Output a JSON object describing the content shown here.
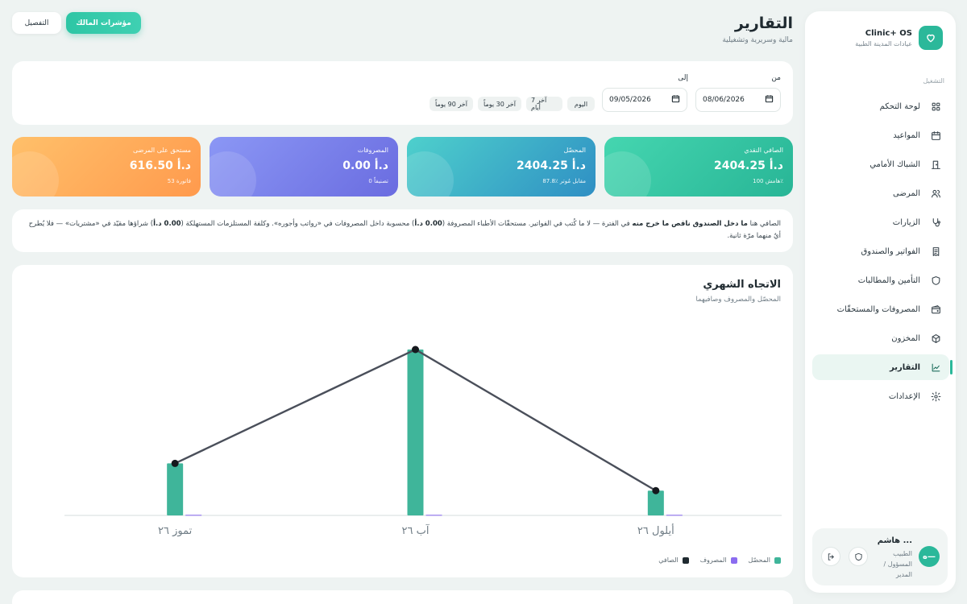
{
  "brand": {
    "name": "Clinic+ OS",
    "subtitle": "عيادات المدينة الطبية"
  },
  "sidebar": {
    "section": "التشغيل",
    "items": [
      {
        "label": "لوحة التحكم",
        "icon": "grid-icon"
      },
      {
        "label": "المواعيد",
        "icon": "calendar-icon"
      },
      {
        "label": "الشباك الأمامي",
        "icon": "door-icon"
      },
      {
        "label": "المرضى",
        "icon": "users-icon"
      },
      {
        "label": "الزيارات",
        "icon": "stethoscope-icon"
      },
      {
        "label": "الفواتير والصندوق",
        "icon": "receipt-icon"
      },
      {
        "label": "التأمين والمطالبات",
        "icon": "shield-icon"
      },
      {
        "label": "المصروفات والمستحقّات",
        "icon": "wallet-icon"
      },
      {
        "label": "المخزون",
        "icon": "box-icon"
      },
      {
        "label": "التقارير",
        "icon": "chart-icon",
        "active": true
      },
      {
        "label": "الإعدادات",
        "icon": "gear-icon"
      }
    ]
  },
  "user": {
    "name": "هاشم ...",
    "role": "الطبيب المسؤول / المدير",
    "avatar": "ه—"
  },
  "header": {
    "title": "التقارير",
    "subtitle": "مالية وسريرية وتشغيلية",
    "owner_btn": "مؤشرات المالك",
    "detail_btn": "التفصيل"
  },
  "filter": {
    "from_label": "من",
    "from_value": "08/06/2026",
    "to_label": "إلى",
    "to_value": "09/05/2026",
    "presets": [
      "اليوم",
      "آخر 7 أيام",
      "آخر 30 يوماً",
      "آخر 90 يوماً"
    ]
  },
  "kpis": [
    {
      "label": "الصافي النقدي",
      "value": "2404.25 د.أ",
      "sub": "هامش 100٪",
      "color": "#2ec4a0"
    },
    {
      "label": "المحصّل",
      "value": "2404.25 د.أ",
      "sub": "87.8٪ مقابل مُوتر",
      "color": "#3fb5c9"
    },
    {
      "label": "المصروفات",
      "value": "0.00 د.أ",
      "sub": "0 تصنيفاً",
      "color": "#7a7ff0"
    },
    {
      "label": "مستحق على المرضى",
      "value": "616.50 د.أ",
      "sub": "53 فاتورة",
      "color": "#ffa85a"
    }
  ],
  "note": {
    "p1": "الصافي هنا ",
    "b1": "ما دخل الصندوق ناقص ما خرج منه",
    "p2": " في الفترة — لا ما كُتب في الفواتير. مستحقّات الأطباء المصروفة (",
    "b2": "0.00 د.أ",
    "p3": ") محسوبة داخل المصروفات في «رواتب وأجوره». وكلفة المستلزمات المستهلكة (",
    "b3": "0.00 د.أ",
    "p4": ") شراؤها مقيّد في «مشتريات» — فلا يُطرح أيٌ منهما مرّة ثانية."
  },
  "chart": {
    "title": "الاتجاه الشهري",
    "subtitle": "المحصّل والمصروف وصافيهما"
  },
  "chart_data": {
    "type": "bar",
    "categories": [
      "تموز ٢٦",
      "آب ٢٦",
      "أيلول ٢٦"
    ],
    "series": [
      {
        "name": "المحصّل",
        "type": "bar",
        "color": "#3fb59a",
        "values": [
          420,
          1340,
          200
        ]
      },
      {
        "name": "المصروف",
        "type": "bar",
        "color": "#8b6cf0",
        "values": [
          0,
          0,
          0
        ]
      },
      {
        "name": "الصافي",
        "type": "line",
        "color": "#1f2a30",
        "values": [
          420,
          1340,
          200
        ]
      }
    ],
    "ylim": [
      0,
      1340
    ]
  }
}
